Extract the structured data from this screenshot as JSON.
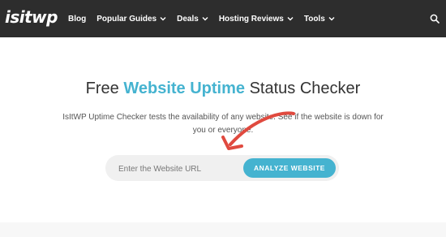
{
  "header": {
    "logo": "isitwp",
    "nav": [
      {
        "label": "Blog",
        "has_dropdown": false
      },
      {
        "label": "Popular Guides",
        "has_dropdown": true
      },
      {
        "label": "Deals",
        "has_dropdown": true
      },
      {
        "label": "Hosting Reviews",
        "has_dropdown": true
      },
      {
        "label": "Tools",
        "has_dropdown": true
      }
    ],
    "search_icon": "search-icon"
  },
  "hero": {
    "title_prefix": "Free ",
    "title_accent": "Website Uptime",
    "title_suffix": " Status Checker",
    "subtitle": "IsItWP Uptime Checker tests the availability of any website. See if the website is down for you or everyone."
  },
  "form": {
    "url_placeholder": "Enter the Website URL",
    "url_value": "",
    "analyze_label": "ANALYZE WEBSITE"
  },
  "colors": {
    "topbar": "#2d2d2d",
    "accent": "#45b3d0",
    "arrow": "#e04a3f"
  }
}
